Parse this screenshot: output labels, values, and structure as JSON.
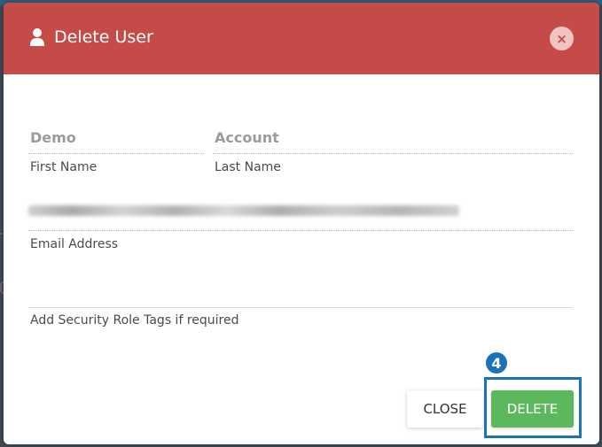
{
  "modal": {
    "title": "Delete User",
    "header_color": "#c44b47",
    "close_icon": "×"
  },
  "fields": {
    "first_name": {
      "value": "Demo",
      "label": "First Name"
    },
    "last_name": {
      "value": "Account",
      "label": "Last Name"
    },
    "email": {
      "label": "Email Address"
    },
    "security_tags": {
      "label": "Add Security Role Tags if required"
    }
  },
  "buttons": {
    "close": "CLOSE",
    "delete": "DELETE",
    "delete_color": "#5cb85c"
  },
  "annotation": {
    "step": "4",
    "color": "#1a73b8"
  },
  "icons": {
    "header": "user-icon",
    "close": "close-icon"
  }
}
